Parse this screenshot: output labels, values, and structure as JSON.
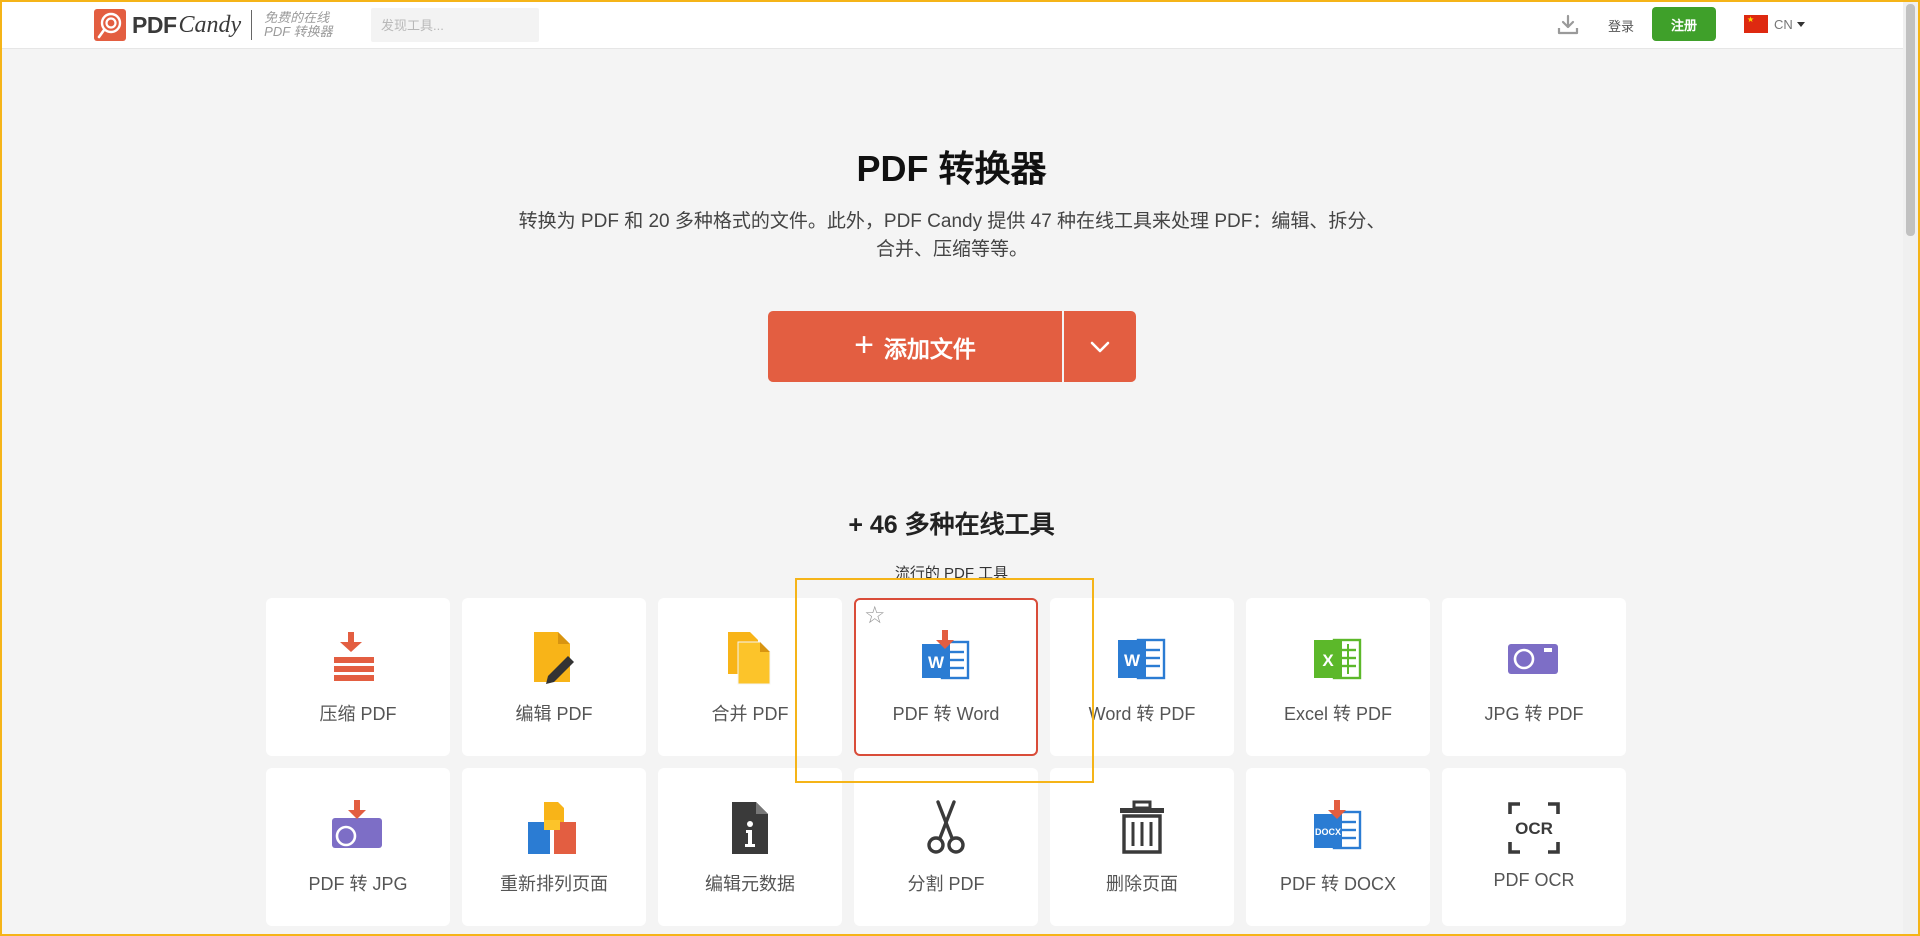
{
  "header": {
    "logo_text_pdf": "PDF",
    "logo_text_candy": "Candy",
    "logo_tagline_1": "免费的在线",
    "logo_tagline_2": "PDF 转换器",
    "search_placeholder": "发现工具...",
    "login_label": "登录",
    "signup_label": "注册",
    "language_code": "CN",
    "signup_color": "#3fa02a"
  },
  "hero": {
    "title": "PDF 转换器",
    "subtitle_line1": "转换为 PDF 和 20 多种格式的文件。此外，PDF Candy 提供 47 种在线工具来处理 PDF：编辑、拆分、",
    "subtitle_line2": "合并、压缩等等。",
    "add_file_label": "添加文件",
    "add_file_icon": "plus-icon",
    "dropdown_icon": "chevron-down-icon",
    "accent_color": "#e35e41"
  },
  "tools": {
    "heading": "+ 46 多种在线工具",
    "subheading": "流行的 PDF 工具",
    "items": [
      {
        "label": "压缩 PDF",
        "icon": "compress-icon"
      },
      {
        "label": "编辑 PDF",
        "icon": "edit-icon"
      },
      {
        "label": "合并 PDF",
        "icon": "merge-icon"
      },
      {
        "label": "PDF 转 Word",
        "icon": "pdf-to-word-icon",
        "active": true
      },
      {
        "label": "Word 转 PDF",
        "icon": "word-icon"
      },
      {
        "label": "Excel 转 PDF",
        "icon": "excel-icon"
      },
      {
        "label": "JPG 转 PDF",
        "icon": "camera-icon"
      },
      {
        "label": "PDF 转 JPG",
        "icon": "pdf-to-jpg-icon"
      },
      {
        "label": "重新排列页面",
        "icon": "rearrange-icon"
      },
      {
        "label": "编辑元数据",
        "icon": "metadata-icon"
      },
      {
        "label": "分割 PDF",
        "icon": "scissors-icon"
      },
      {
        "label": "删除页面",
        "icon": "trash-icon"
      },
      {
        "label": "PDF 转 DOCX",
        "icon": "pdf-to-docx-icon"
      },
      {
        "label": "PDF OCR",
        "icon": "ocr-icon"
      }
    ]
  }
}
